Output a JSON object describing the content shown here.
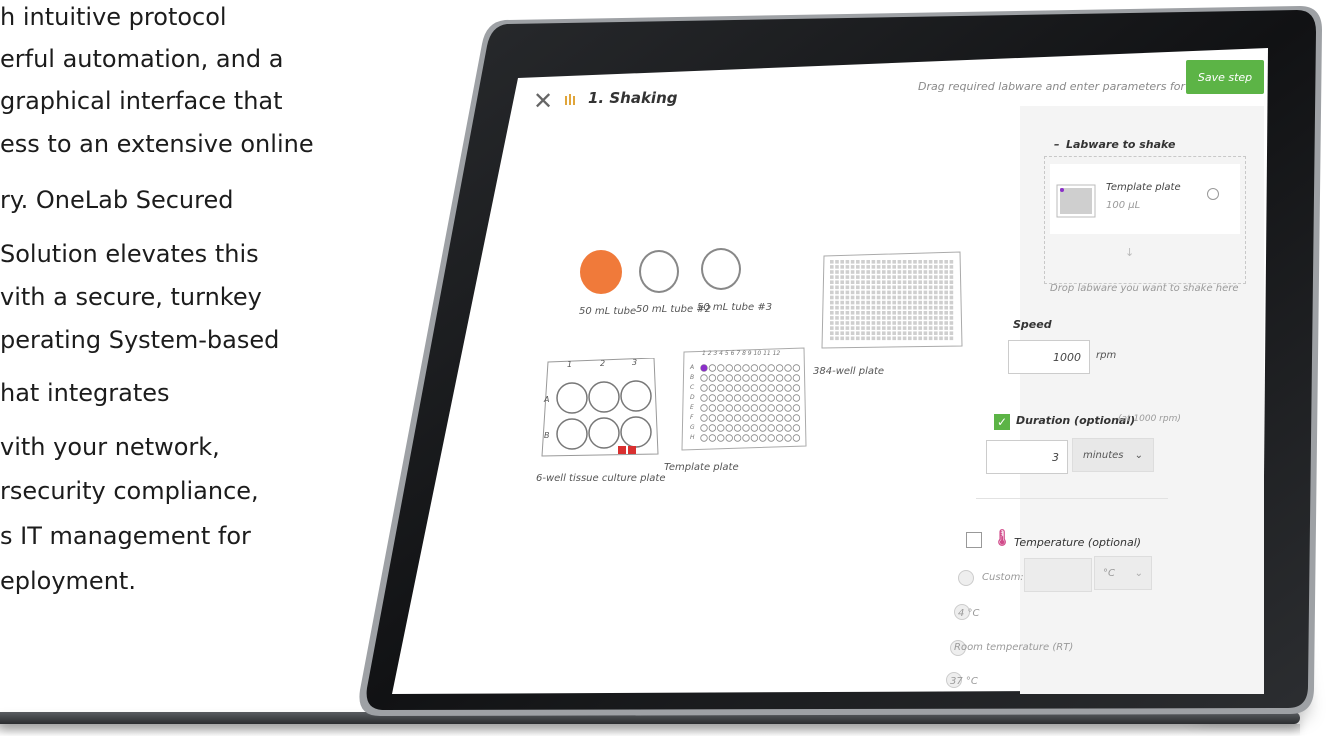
{
  "marketing": {
    "lines": [
      "h intuitive protocol",
      "erful automation, and a",
      "graphical interface that",
      "ess to an extensive online",
      "ry. OneLab Secured",
      "Solution elevates this",
      "vith a secure, turnkey",
      "perating System-based",
      "hat integrates",
      "vith your network,",
      "rsecurity compliance,",
      "s IT management for",
      "eployment."
    ]
  },
  "app": {
    "step_title": "1. Shaking",
    "hint": "Drag required labware and enter parameters for shaking",
    "save_label": "Save step"
  },
  "labware": {
    "tube1": "50 mL tube",
    "tube2": "50 mL tube #2",
    "tube3": "50 mL tube #3",
    "plate384": "384-well plate",
    "plate6": "6-well tissue culture plate",
    "template": "Template plate",
    "plate6_cols": [
      "1",
      "2",
      "3"
    ],
    "plate6_rows": [
      "A",
      "B"
    ],
    "template_cols": "1 2 3 4 5 6 7 8 9 10 11 12",
    "template_rows": [
      "A",
      "B",
      "C",
      "D",
      "E",
      "F",
      "G",
      "H"
    ]
  },
  "panel": {
    "labware_header": "Labware to shake",
    "collapse_symbol": "–",
    "item_name": "Template plate",
    "item_volume": "100 µL",
    "drop_hint": "Drop labware you want to shake here",
    "speed_label": "Speed",
    "speed_value": "1000",
    "speed_unit": "rpm",
    "duration_label": "Duration (optional)",
    "duration_sub": "(at 1000 rpm)",
    "duration_value": "3",
    "duration_unit": "minutes",
    "temp_label": "Temperature (optional)",
    "custom_label": "Custom:",
    "temp_unit": "°C",
    "opt_4c": "4 °C",
    "opt_rt": "Room temperature (RT)",
    "opt_37": "37 °C"
  },
  "colors": {
    "accent": "#5cb446",
    "tube_fill": "#f07a3a",
    "well_marker": "#8b2fc9",
    "tip_red": "#d93030"
  }
}
